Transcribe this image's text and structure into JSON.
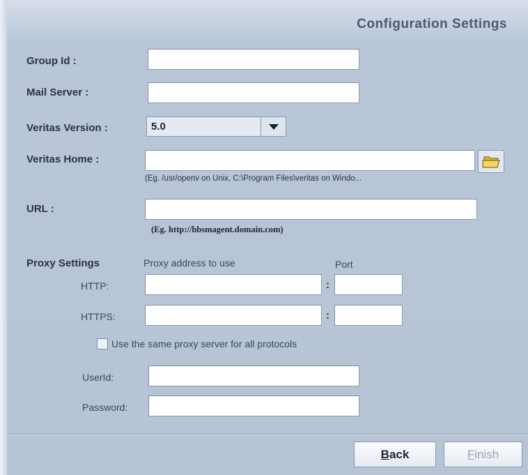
{
  "header": {
    "title": "Configuration Settings"
  },
  "fields": {
    "group_id": {
      "label": "Group Id :",
      "value": ""
    },
    "mail_server": {
      "label": "Mail Server :",
      "value": ""
    },
    "veritas_version": {
      "label": "Veritas Version :",
      "selected": "5.0"
    },
    "veritas_home": {
      "label": "Veritas Home :",
      "value": "",
      "hint": "(Eg. /usr/openv on Unix, C:\\Program Files\\veritas on Windo..."
    },
    "url": {
      "label": "URL :",
      "value": "",
      "hint": "(Eg. http://hbsmagent.domain.com)"
    }
  },
  "proxy": {
    "section_label": "Proxy Settings",
    "address_header": "Proxy address to use",
    "port_header": "Port",
    "http_label": "HTTP:",
    "https_label": "HTTPS:",
    "separator": ":",
    "same_proxy_label": "Use the same proxy server for all protocols",
    "userid_label": "UserId:",
    "password_label": "Password:"
  },
  "buttons": {
    "back": {
      "mnemonic": "B",
      "rest": "ack"
    },
    "finish": {
      "mnemonic": "F",
      "rest": "inish"
    }
  },
  "icons": {
    "browse": "folder-icon",
    "dropdown": "chevron-down-icon"
  }
}
